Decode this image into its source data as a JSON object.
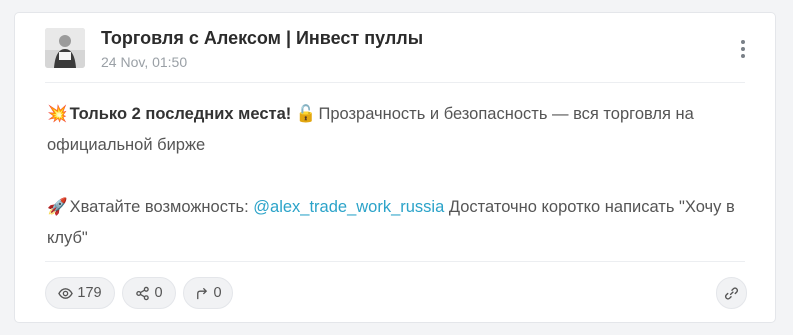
{
  "post": {
    "channel_name": "Торговля с Алексом | Инвест пуллы",
    "time": "24 Nov, 01:50",
    "paragraph1": {
      "emoji": "💥",
      "bold": "Только 2 последних места!",
      "emoji2": "🔓",
      "text": "Прозрачность и безопасность — вся торговля на официальной бирже"
    },
    "paragraph2": {
      "emoji": "🚀",
      "text_before": "Хватайте возможность: ",
      "mention": "@alex_trade_work_russia",
      "text_after": " Достаточно коротко написать \"Хочу в клуб\""
    }
  },
  "footer": {
    "views": "179",
    "shares": "0",
    "forwards": "0"
  },
  "icons": {
    "views": "eye-icon",
    "shares": "share-nodes-icon",
    "forwards": "forward-arrow-icon",
    "link": "link-icon",
    "menu": "more-vertical-icon"
  },
  "colors": {
    "mention": "#2ba3c9",
    "card_bg": "#ffffff",
    "page_bg": "#f3f4f6"
  }
}
